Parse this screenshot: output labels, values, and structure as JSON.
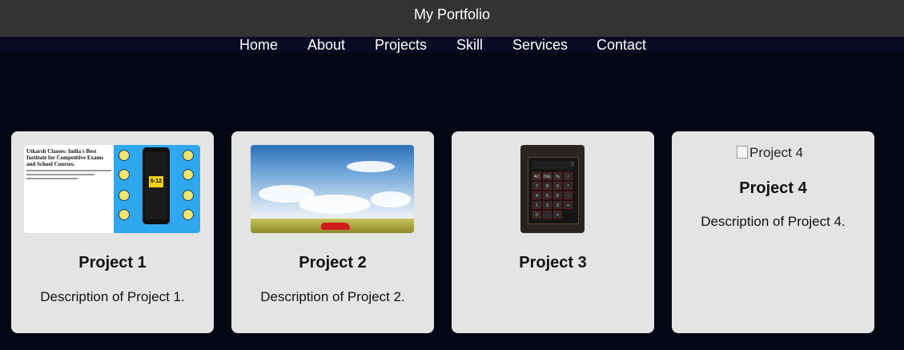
{
  "header": {
    "title": "My Portfolio"
  },
  "nav": {
    "items": [
      "Home",
      "About",
      "Projects",
      "Skill",
      "Services",
      "Contact"
    ]
  },
  "projects": [
    {
      "title": "Project 1",
      "description": "Description of Project 1.",
      "image_text": {
        "headline": "Utkarsh Classes: India's Best Institute for Competitive Exams and School Courses.",
        "badge": "6-12"
      }
    },
    {
      "title": "Project 2",
      "description": "Description of Project 2."
    },
    {
      "title": "Project 3",
      "description": "",
      "calc_display": "0",
      "calc_keys": [
        "AC",
        "DEL",
        "%",
        "/",
        "7",
        "8",
        "9",
        "*",
        "4",
        "5",
        "6",
        "-",
        "1",
        "2",
        "3",
        "+",
        "0",
        ".",
        "="
      ]
    },
    {
      "title": "Project 4",
      "description": "Description of Project 4.",
      "image_alt": "Project 4"
    }
  ],
  "colors": {
    "page_bg": "#050614",
    "header_bg": "#333333",
    "card_bg": "#e4e4e4",
    "nav_text": "#ffffff"
  }
}
